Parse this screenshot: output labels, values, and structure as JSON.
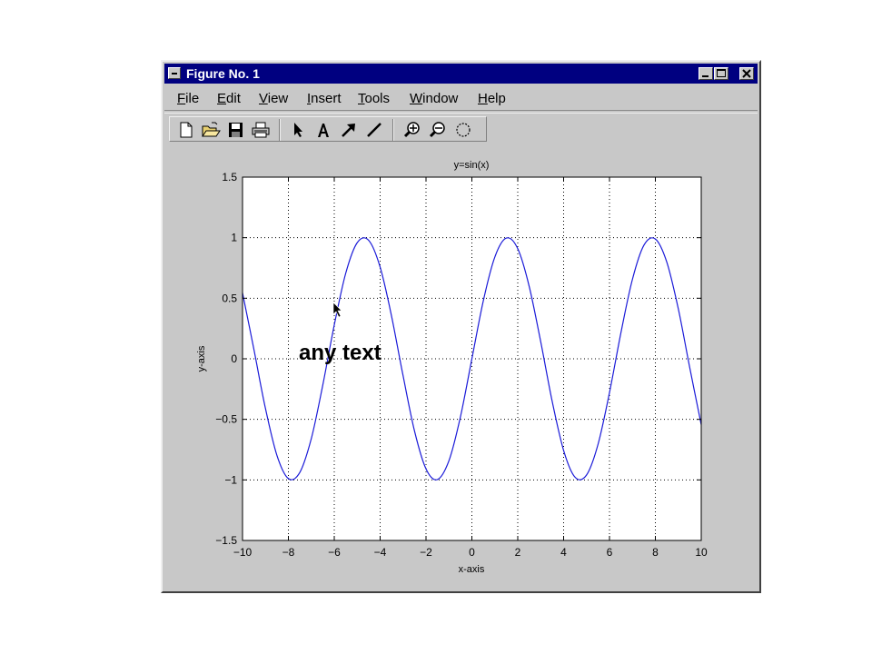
{
  "window": {
    "title": "Figure No. 1"
  },
  "menubar": {
    "items": [
      "File",
      "Edit",
      "View",
      "Insert",
      "Tools",
      "Window",
      "Help"
    ]
  },
  "toolbar": {
    "buttons": [
      "new-file",
      "open-folder",
      "save",
      "print",
      "select-arrow",
      "insert-text",
      "insert-arrow",
      "insert-line",
      "zoom-in",
      "zoom-out",
      "rotate-3d"
    ]
  },
  "figure": {
    "annotation": "any text"
  },
  "chart_data": {
    "type": "line",
    "title": "y=sin(x)",
    "xlabel": "x-axis",
    "ylabel": "y-axis",
    "xlim": [
      -10,
      10
    ],
    "ylim": [
      -1.5,
      1.5
    ],
    "xticks": [
      -10,
      -8,
      -6,
      -4,
      -2,
      0,
      2,
      4,
      6,
      8,
      10
    ],
    "yticks": [
      -1.5,
      -1,
      -0.5,
      0,
      0.5,
      1,
      1.5
    ],
    "xtick_labels": [
      "−10",
      "−8",
      "−6",
      "−4",
      "−2",
      "0",
      "2",
      "4",
      "6",
      "8",
      "10"
    ],
    "ytick_labels": [
      "−1.5",
      "−1",
      "−0.5",
      "0",
      "0.5",
      "1",
      "1.5"
    ],
    "grid": true,
    "grid_style": "dotted",
    "series": [
      {
        "function": "sin(x)",
        "color": "#1a1ad8",
        "x": [
          -10,
          -9.5,
          -9,
          -8.5,
          -8,
          -7.5,
          -7,
          -6.5,
          -6,
          -5.5,
          -5,
          -4.5,
          -4,
          -3.5,
          -3,
          -2.5,
          -2,
          -1.5,
          -1,
          -0.5,
          0,
          0.5,
          1,
          1.5,
          2,
          2.5,
          3,
          3.5,
          4,
          4.5,
          5,
          5.5,
          6,
          6.5,
          7,
          7.5,
          8,
          8.5,
          9,
          9.5,
          10
        ],
        "y": [
          0.544,
          0.075,
          -0.412,
          -0.798,
          -0.989,
          -0.938,
          -0.657,
          -0.215,
          0.279,
          0.706,
          0.959,
          0.978,
          0.757,
          0.351,
          -0.141,
          -0.598,
          -0.909,
          -0.997,
          -0.841,
          -0.479,
          0,
          0.479,
          0.841,
          0.997,
          0.909,
          0.598,
          0.141,
          -0.351,
          -0.757,
          -0.978,
          -0.959,
          -0.706,
          -0.279,
          0.215,
          0.657,
          0.938,
          0.989,
          0.798,
          0.412,
          -0.075,
          -0.544
        ]
      }
    ]
  }
}
